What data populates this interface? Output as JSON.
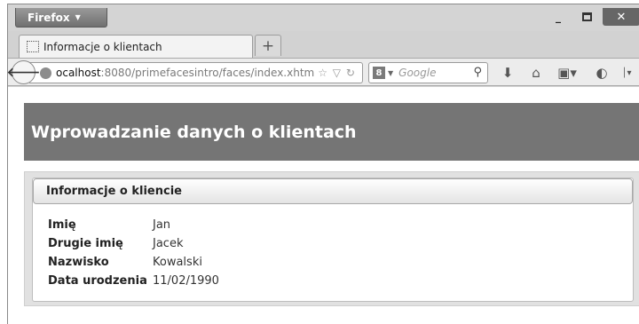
{
  "browser": {
    "menu_label": "Firefox",
    "tab_title": "Informacje o klientach",
    "url_host": "ocalhost",
    "url_rest": ":8080/primefacesintro/faces/index.xhtm",
    "search_placeholder": "Google"
  },
  "page": {
    "header_title": "Wprowadzanie danych o klientach",
    "panel_title": "Informacje o kliencie",
    "fields": [
      {
        "label": "Imię",
        "value": "Jan"
      },
      {
        "label": "Drugie imię",
        "value": "Jacek"
      },
      {
        "label": "Nazwisko",
        "value": "Kowalski"
      },
      {
        "label": "Data urodzenia",
        "value": "11/02/1990"
      }
    ]
  },
  "colors": {
    "header_band": "#757575",
    "window_chrome": "#d4d4d4"
  }
}
